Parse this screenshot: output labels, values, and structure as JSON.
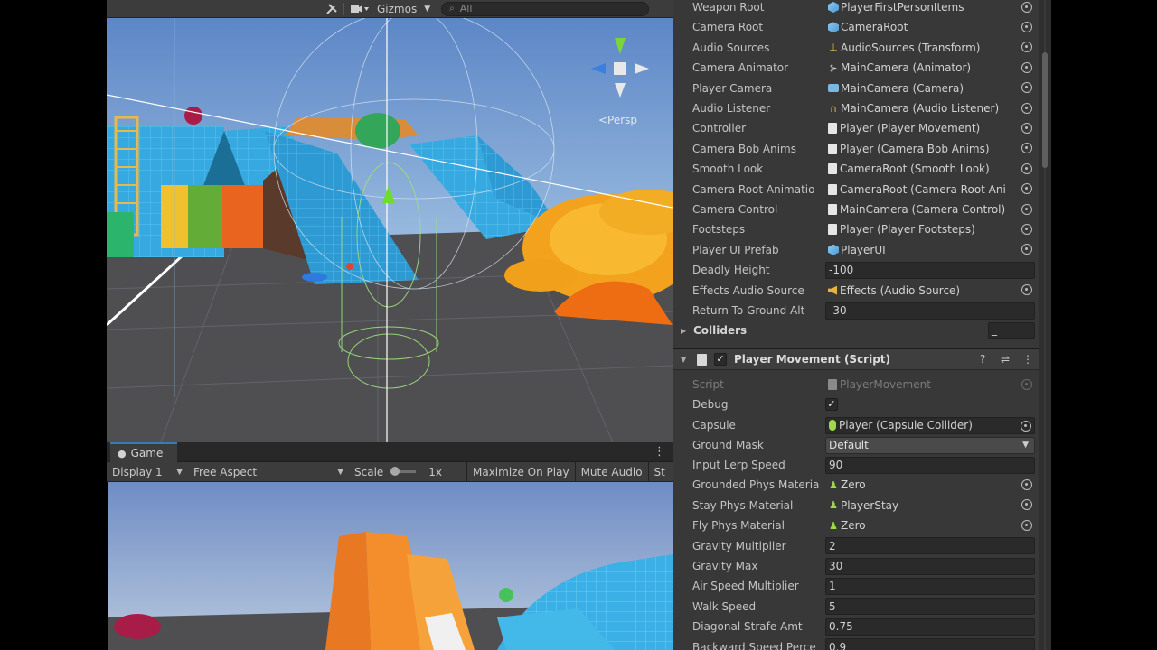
{
  "scene": {
    "toolbar": {
      "tools_icon": "tools-icon",
      "camera_icon": "camera-icon",
      "gizmos_label": "Gizmos",
      "search_placeholder": "All"
    },
    "persp_label": "<Persp"
  },
  "game": {
    "tab_label": "Game",
    "display_label": "Display 1",
    "aspect_label": "Free Aspect",
    "scale_label": "Scale",
    "scale_value": "1x",
    "maximize_label": "Maximize On Play",
    "mute_label": "Mute Audio",
    "stats_label": "St"
  },
  "inspector": {
    "top_rows": [
      {
        "label": "Weapon Root",
        "value": "PlayerFirstPersonItems",
        "icon": "prefab"
      },
      {
        "label": "Camera Root",
        "value": "CameraRoot",
        "icon": "prefab"
      },
      {
        "label": "Audio Sources",
        "value": "AudioSources (Transform)",
        "icon": "transform"
      },
      {
        "label": "Camera Animator",
        "value": "MainCamera (Animator)",
        "icon": "animator"
      },
      {
        "label": "Player Camera",
        "value": "MainCamera (Camera)",
        "icon": "camera"
      },
      {
        "label": "Audio Listener",
        "value": "MainCamera (Audio Listener)",
        "icon": "listener"
      },
      {
        "label": "Controller",
        "value": "Player (Player Movement)",
        "icon": "script"
      },
      {
        "label": "Camera Bob Anims",
        "value": "Player (Camera Bob Anims)",
        "icon": "script"
      },
      {
        "label": "Smooth Look",
        "value": "CameraRoot (Smooth Look)",
        "icon": "script"
      },
      {
        "label": "Camera Root Animatio",
        "value": "CameraRoot (Camera Root Ani",
        "icon": "script"
      },
      {
        "label": "Camera Control",
        "value": "MainCamera (Camera Control)",
        "icon": "script"
      },
      {
        "label": "Footsteps",
        "value": "Player (Player Footsteps)",
        "icon": "script"
      },
      {
        "label": "Player UI Prefab",
        "value": "PlayerUI",
        "icon": "prefab"
      },
      {
        "label": "Deadly Height",
        "value": "-100",
        "icon": ""
      },
      {
        "label": "Effects Audio Source",
        "value": "Effects (Audio Source)",
        "icon": "audio"
      },
      {
        "label": "Return To Ground Alt",
        "value": "-30",
        "icon": ""
      }
    ],
    "colliders_label": "Colliders",
    "colliders_count": "_",
    "component": {
      "title": "Player Movement (Script)",
      "enabled": "✓",
      "help_icon": "help-icon",
      "preset_icon": "preset-icon",
      "menu_icon": "menu-icon"
    },
    "script_row": {
      "label": "Script",
      "value": "PlayerMovement"
    },
    "debug_row": {
      "label": "Debug",
      "value": "✓"
    },
    "capsule_row": {
      "label": "Capsule",
      "value": "Player (Capsule Collider)"
    },
    "ground_mask_row": {
      "label": "Ground Mask",
      "value": "Default"
    },
    "bottom_rows": [
      {
        "label": "Input Lerp Speed",
        "value": "90",
        "icon": ""
      },
      {
        "label": "Grounded Phys Materia",
        "value": "Zero",
        "icon": "phys"
      },
      {
        "label": "Stay Phys Material",
        "value": "PlayerStay",
        "icon": "phys"
      },
      {
        "label": "Fly Phys Material",
        "value": "Zero",
        "icon": "phys"
      },
      {
        "label": "Gravity Multiplier",
        "value": "2",
        "icon": ""
      },
      {
        "label": "Gravity Max",
        "value": "30",
        "icon": ""
      },
      {
        "label": "Air Speed Multiplier",
        "value": "1",
        "icon": ""
      },
      {
        "label": "Walk Speed",
        "value": "5",
        "icon": ""
      },
      {
        "label": "Diagonal Strafe Amt",
        "value": "0.75",
        "icon": ""
      },
      {
        "label": "Backward Speed Perce",
        "value": "0.9",
        "icon": ""
      }
    ]
  }
}
